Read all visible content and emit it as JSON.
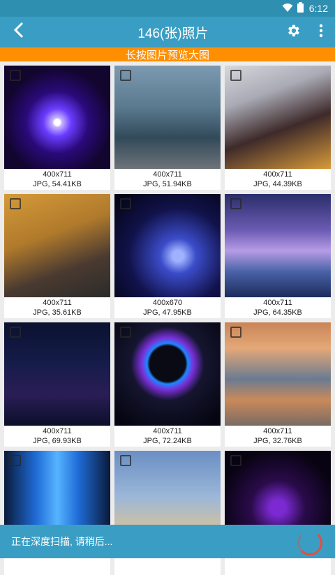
{
  "status_bar": {
    "time": "6:12"
  },
  "header": {
    "title": "146(张)照片"
  },
  "banner": {
    "text": "长按图片预览大图"
  },
  "photos": [
    {
      "dims": "400x711",
      "meta": "JPG, 54.41KB"
    },
    {
      "dims": "400x711",
      "meta": "JPG, 51.94KB"
    },
    {
      "dims": "400x711",
      "meta": "JPG, 44.39KB"
    },
    {
      "dims": "400x711",
      "meta": "JPG, 35.61KB"
    },
    {
      "dims": "400x670",
      "meta": "JPG, 47.95KB"
    },
    {
      "dims": "400x711",
      "meta": "JPG, 64.35KB"
    },
    {
      "dims": "400x711",
      "meta": "JPG, 69.93KB"
    },
    {
      "dims": "400x711",
      "meta": "JPG, 72.24KB"
    },
    {
      "dims": "400x711",
      "meta": "JPG, 32.76KB"
    },
    {
      "dims": "",
      "meta": ""
    },
    {
      "dims": "",
      "meta": ""
    },
    {
      "dims": "",
      "meta": ""
    }
  ],
  "bottom_bar": {
    "status_text": "正在深度扫描, 请稍后..."
  },
  "colors": {
    "app_bar": "#3a9ec4",
    "banner": "#ff8f00",
    "spinner": "#e94b3c"
  }
}
